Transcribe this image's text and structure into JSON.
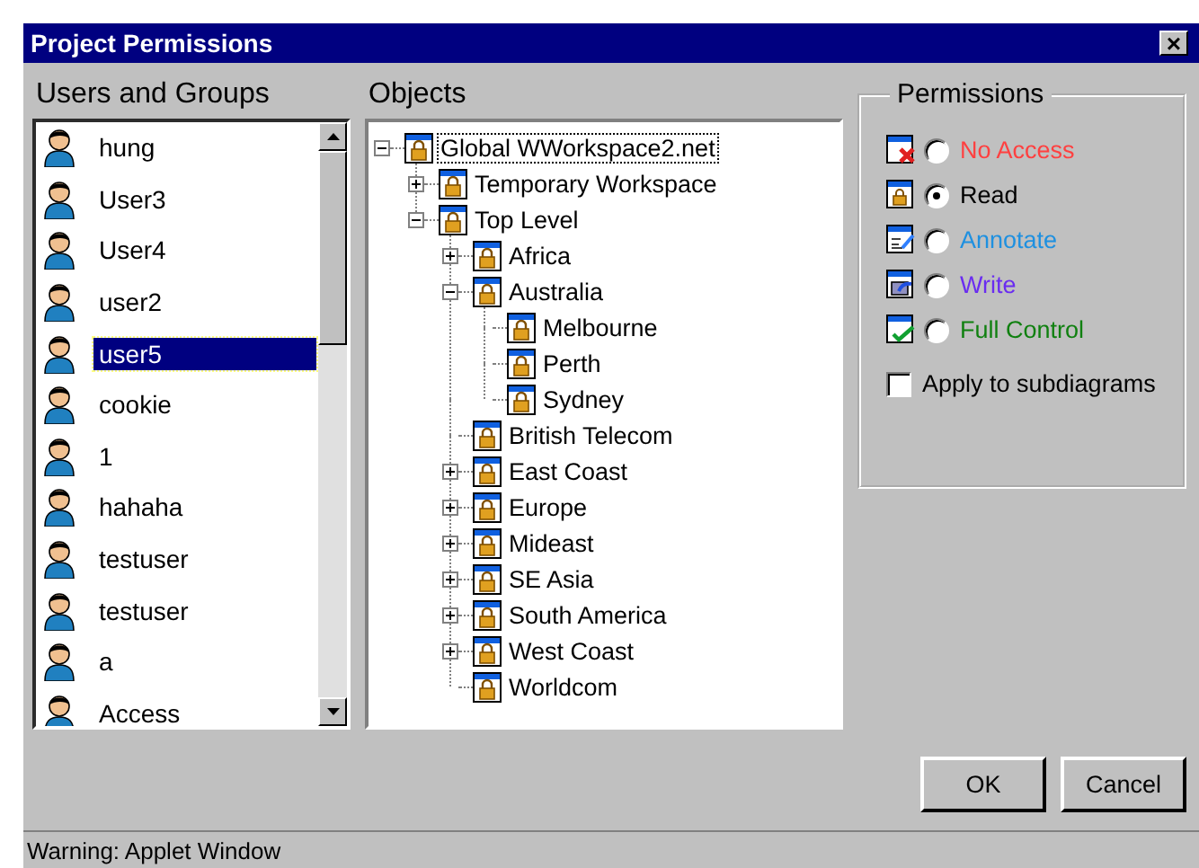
{
  "window": {
    "title": "Project Permissions",
    "close": "×"
  },
  "users": {
    "heading": "Users and Groups",
    "items": [
      {
        "name": "hung",
        "selected": false
      },
      {
        "name": "User3",
        "selected": false
      },
      {
        "name": "User4",
        "selected": false
      },
      {
        "name": "user2",
        "selected": false
      },
      {
        "name": "user5",
        "selected": true
      },
      {
        "name": "cookie",
        "selected": false
      },
      {
        "name": "1",
        "selected": false
      },
      {
        "name": "hahaha",
        "selected": false
      },
      {
        "name": "testuser",
        "selected": false
      },
      {
        "name": "testuser",
        "selected": false
      },
      {
        "name": "a",
        "selected": false
      },
      {
        "name": "Access",
        "selected": false
      }
    ]
  },
  "objects": {
    "heading": "Objects",
    "tree": [
      {
        "label": "Global WWorkspace2.net",
        "kind": "group",
        "expanded": true,
        "selected": true,
        "children": [
          {
            "label": "Temporary Workspace",
            "kind": "group",
            "expanded": false,
            "selected": false
          },
          {
            "label": "Top Level",
            "kind": "group",
            "expanded": true,
            "selected": false,
            "children": [
              {
                "label": "Africa",
                "kind": "group",
                "expanded": false,
                "selected": false
              },
              {
                "label": "Australia",
                "kind": "group",
                "expanded": true,
                "selected": false,
                "children": [
                  {
                    "label": "Melbourne",
                    "selected": false
                  },
                  {
                    "label": "Perth",
                    "selected": false
                  },
                  {
                    "label": "Sydney",
                    "selected": false
                  }
                ]
              },
              {
                "label": "British Telecom",
                "selected": false
              },
              {
                "label": "East Coast",
                "kind": "group",
                "expanded": false,
                "selected": false
              },
              {
                "label": "Europe",
                "kind": "group",
                "expanded": false,
                "selected": false
              },
              {
                "label": "Mideast",
                "kind": "group",
                "expanded": false,
                "selected": false
              },
              {
                "label": "SE Asia",
                "kind": "group",
                "expanded": false,
                "selected": false
              },
              {
                "label": "South America",
                "kind": "group",
                "expanded": false,
                "selected": false
              },
              {
                "label": "West Coast",
                "kind": "group",
                "expanded": false,
                "selected": false
              },
              {
                "label": "Worldcom",
                "selected": false
              }
            ]
          }
        ]
      }
    ]
  },
  "permissions": {
    "heading": "Permissions",
    "options": [
      {
        "label": "No Access",
        "kind": "none",
        "color": "#ff4040",
        "selected": false
      },
      {
        "label": "Read",
        "kind": "read",
        "color": "#000000",
        "selected": true
      },
      {
        "label": "Annotate",
        "kind": "annotate",
        "color": "#1e90e0",
        "selected": false
      },
      {
        "label": "Write",
        "kind": "write",
        "color": "#6a2cf0",
        "selected": false
      },
      {
        "label": "Full Control",
        "kind": "full",
        "color": "#108010",
        "selected": false
      }
    ],
    "apply_subdiagrams": {
      "label": "Apply to subdiagrams",
      "checked": false
    }
  },
  "buttons": [
    "OK",
    "Cancel"
  ],
  "status_bar": "Warning: Applet Window"
}
